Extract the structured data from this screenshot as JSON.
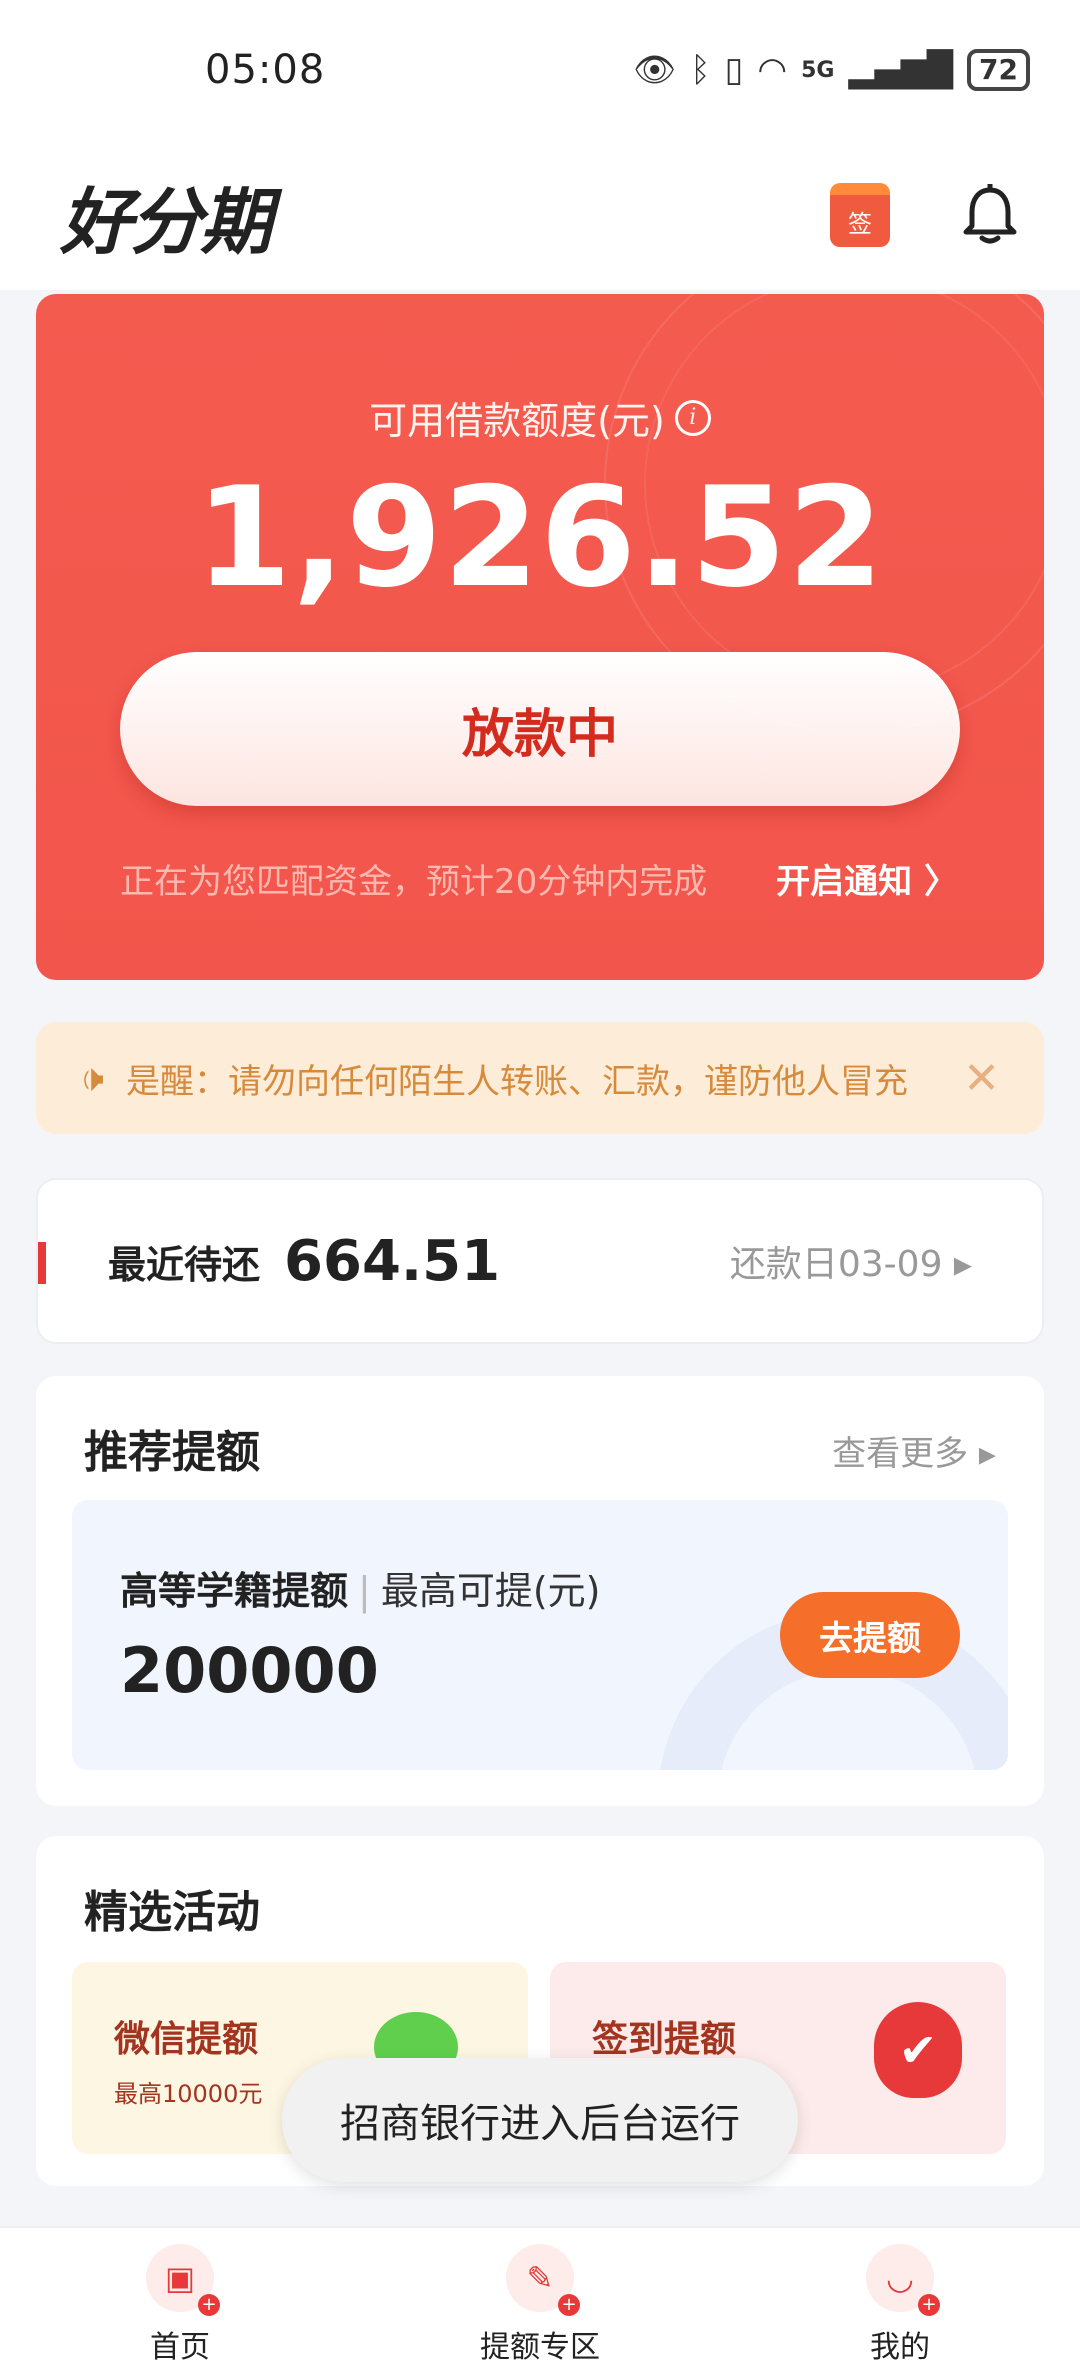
{
  "status_bar": {
    "time": "05:08",
    "network": "5G",
    "battery": "72",
    "icons": [
      "eye-icon",
      "bluetooth-icon",
      "vibrate-icon",
      "wifi-icon",
      "signal-icon",
      "battery-icon"
    ]
  },
  "header": {
    "logo": "好分期",
    "sign_label": "签",
    "icons": [
      "calendar-sign-icon",
      "bell-icon"
    ]
  },
  "hero": {
    "label": "可用借款额度(元)",
    "info_glyph": "i",
    "amount": "1,926.52",
    "button_label": "放款中",
    "note": "正在为您匹配资金，预计20分钟内完成",
    "notify_link": "开启通知 〉",
    "colors": {
      "background": "#f2554b",
      "button_text": "#d42b1f"
    }
  },
  "notice": {
    "text": "是醒：请勿向任何陌生人转账、汇款，谨防他人冒充",
    "speaker_glyph": "🕩",
    "close_glyph": "✕",
    "colors": {
      "background": "#fdecd8",
      "text": "#d68b3c"
    }
  },
  "repayment": {
    "label": "最近待还",
    "amount": "664.51",
    "due": "还款日03-09 ▸"
  },
  "recommend": {
    "title": "推荐提额",
    "see_more": "查看更多 ▸",
    "item": {
      "name": "高等学籍提额",
      "separator": "|",
      "subtitle": "最高可提(元)",
      "value": "200000",
      "button_label": "去提额"
    }
  },
  "activities": {
    "title": "精选活动",
    "items": [
      {
        "title": "微信提额",
        "subtitle": "最高10000元"
      },
      {
        "title": "签到提额",
        "subtitle": "",
        "glyph": "✔"
      }
    ]
  },
  "toast": {
    "text": "招商银行进入后台运行"
  },
  "bottom_nav": {
    "items": [
      {
        "label": "首页",
        "icon": "home-icon",
        "glyph": "▣"
      },
      {
        "label": "提额专区",
        "icon": "quota-zone-icon",
        "glyph": "✎"
      },
      {
        "label": "我的",
        "icon": "profile-icon",
        "glyph": "◡"
      }
    ],
    "plus_glyph": "+"
  }
}
